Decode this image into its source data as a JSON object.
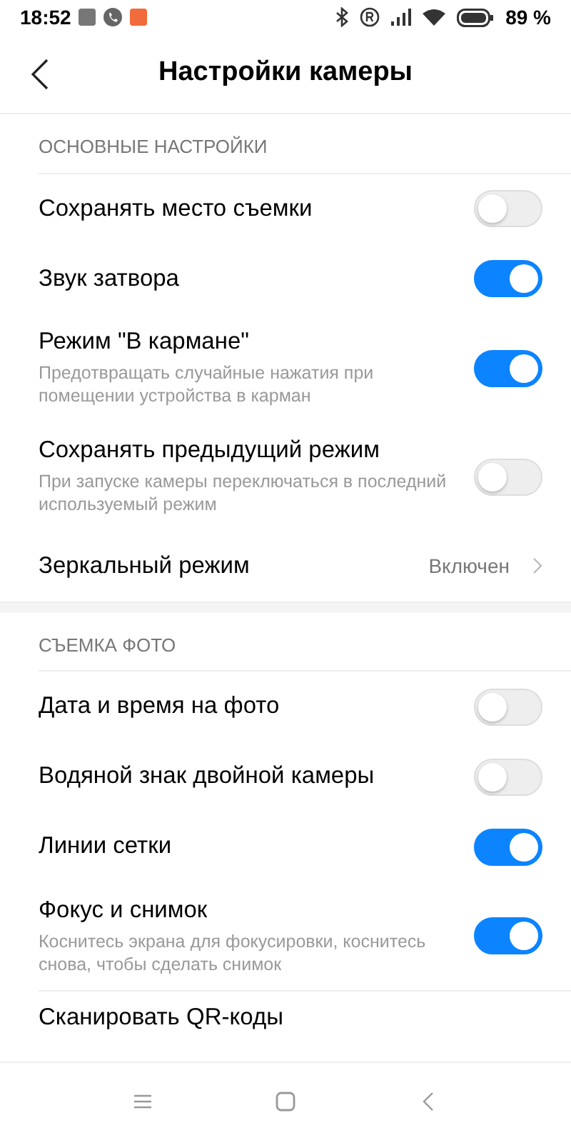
{
  "status_bar": {
    "time": "18:52",
    "battery": "89 %"
  },
  "header": {
    "title": "Настройки камеры"
  },
  "sections": [
    {
      "title": "ОСНОВНЫЕ НАСТРОЙКИ",
      "items": [
        {
          "kind": "toggle",
          "label": "Сохранять место съемки",
          "on": false
        },
        {
          "kind": "toggle",
          "label": "Звук затвора",
          "on": true
        },
        {
          "kind": "toggle",
          "label": "Режим \"В кармане\"",
          "description": "Предотвращать случайные нажатия при помещении устройства в карман",
          "on": true
        },
        {
          "kind": "toggle",
          "label": "Сохранять предыдущий режим",
          "description": "При запуске камеры переключаться в последний используемый режим",
          "on": false
        },
        {
          "kind": "link",
          "label": "Зеркальный режим",
          "value": "Включен"
        }
      ]
    },
    {
      "title": "СЪЕМКА ФОТО",
      "items": [
        {
          "kind": "toggle",
          "label": "Дата и время на фото",
          "on": false
        },
        {
          "kind": "toggle",
          "label": "Водяной знак двойной камеры",
          "on": false
        },
        {
          "kind": "toggle",
          "label": "Линии сетки",
          "on": true
        },
        {
          "kind": "toggle",
          "label": "Фокус и снимок",
          "description": "Коснитесь экрана для фокусировки, коснитесь снова, чтобы сделать снимок",
          "on": true
        },
        {
          "kind": "link",
          "label": "Сканировать QR-коды"
        }
      ]
    }
  ]
}
